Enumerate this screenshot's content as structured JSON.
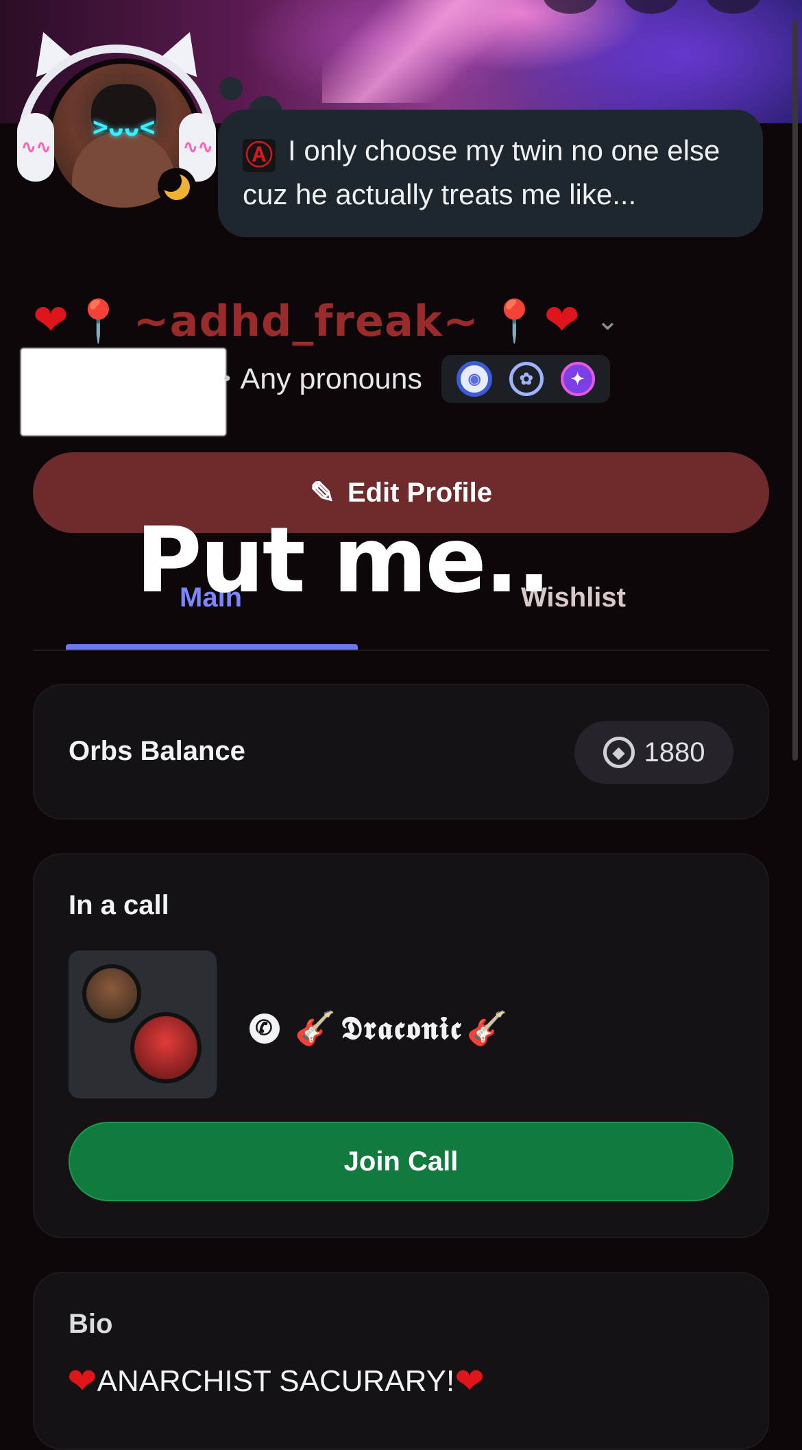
{
  "status": {
    "text": "I only choose my twin no one else cuz he actually treats me like..."
  },
  "profile": {
    "display_name": "~adhd_freak~",
    "pronouns": "Any pronouns",
    "edit_label": "Edit Profile",
    "overlay_caption": "Put me.."
  },
  "tabs": [
    {
      "label": "Main",
      "active": true
    },
    {
      "label": "Wishlist",
      "active": false
    }
  ],
  "orbs": {
    "label": "Orbs Balance",
    "value": "1880"
  },
  "call": {
    "label": "In a call",
    "channel_name": "𝕯𝖗𝖆𝖈𝖔𝖓𝖎𝖈",
    "join_label": "Join Call"
  },
  "bio": {
    "label": "Bio",
    "text": "ANARCHIST SACURARY!"
  },
  "icons": {
    "status_icon": "anarchy-icon",
    "presence": "idle-moon-icon",
    "badges": [
      "nitro-badge-icon",
      "laurel-badge-icon",
      "quest-badge-icon"
    ]
  },
  "colors": {
    "accent": "#6c78f0",
    "edit_button": "#6f2b2b",
    "join_button": "#117a3e",
    "name_color": "#9a2b2b"
  }
}
